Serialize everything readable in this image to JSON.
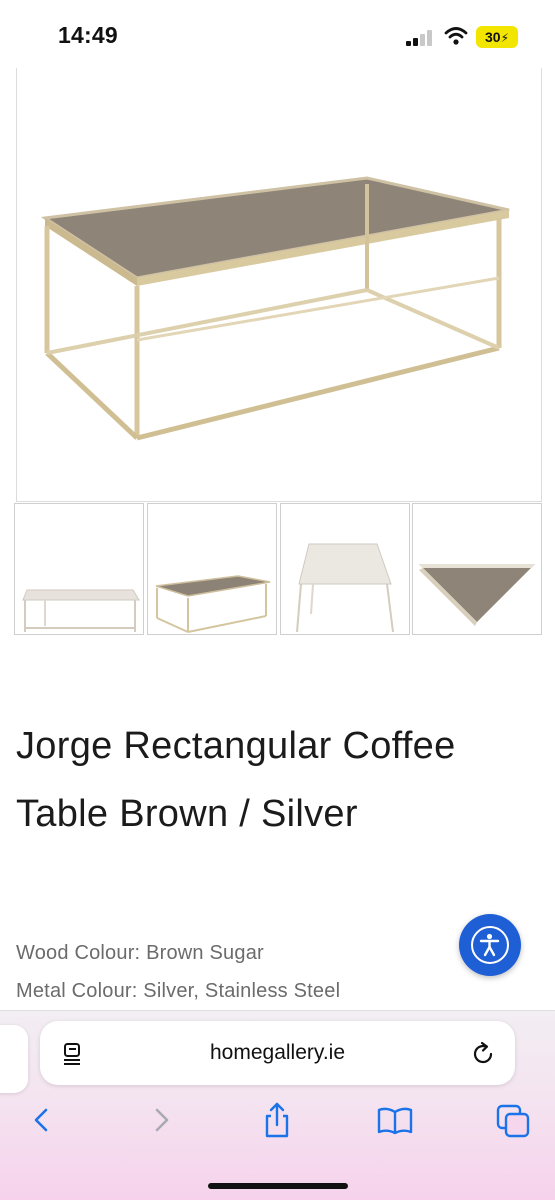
{
  "status_bar": {
    "time": "14:49",
    "battery": "30",
    "icons": [
      "signal-icon",
      "wifi-icon",
      "battery-icon"
    ]
  },
  "gallery": {
    "main_image": "coffee-table-angled-view",
    "thumbnails": [
      "table-front-view",
      "table-angled-view",
      "table-top-view",
      "table-corner-detail"
    ]
  },
  "product": {
    "title": "Jorge Rectangular Coffee Table Brown / Silver",
    "specs": {
      "wood_colour": "Wood Colour: Brown Sugar",
      "metal_colour": "Metal Colour: Silver, Stainless Steel"
    }
  },
  "accessibility": {
    "icon": "accessibility-icon",
    "color": "#1f5fd6"
  },
  "browser": {
    "url": "homegallery.ie",
    "icons": [
      "reader-icon",
      "reload-icon",
      "back-icon",
      "forward-icon",
      "share-icon",
      "bookmarks-icon",
      "tabs-icon"
    ],
    "accent": "#1a73e8"
  }
}
